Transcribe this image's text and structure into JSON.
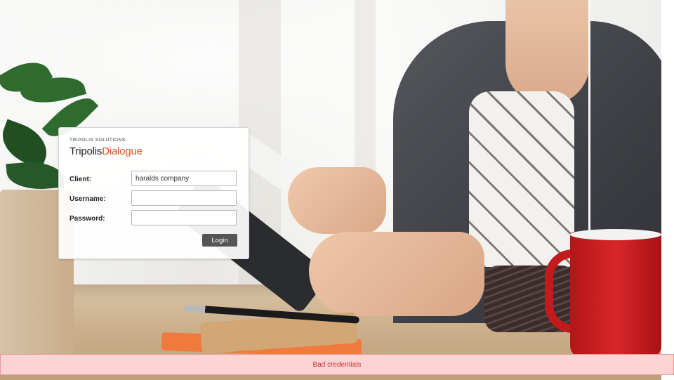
{
  "brand": {
    "company": "TRIPOLIS SOLUTIONS",
    "product_primary": "Tripolis",
    "product_accent": "Dialogue",
    "accent_color": "#e4511e"
  },
  "login": {
    "client_label": "Client:",
    "client_value": "haralds company",
    "username_label": "Username:",
    "username_value": "",
    "password_label": "Password:",
    "password_value": "",
    "submit_label": "Login"
  },
  "error": {
    "message": "Bad credentials",
    "background": "#fdd3d3",
    "text_color": "#c73a3a"
  }
}
